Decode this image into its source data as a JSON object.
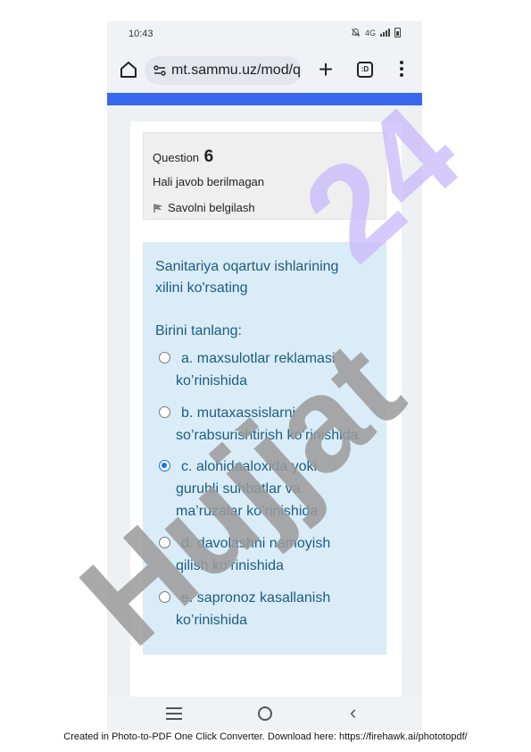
{
  "statusbar": {
    "time": "10:43",
    "network": "4G"
  },
  "browser": {
    "url": "mt.sammu.uz/mod/q",
    "tabs_label": ":D"
  },
  "question": {
    "label": "Question",
    "number": "6",
    "state": "Hali javob berilmagan",
    "flag_label": "Savolni belgilash",
    "text": "Sanitariya oqartuv ishlarining xilini ko'rsating",
    "prompt": "Birini tanlang:",
    "answers": [
      {
        "lines": [
          "a. maxsulotlar reklamasi",
          "ko’rinishida"
        ],
        "checked": false
      },
      {
        "lines": [
          "b. mutaxassislarni",
          "so’rabsurishtirish ko’rinishida"
        ],
        "checked": false
      },
      {
        "lines": [
          "c. alohidaaloxida yoki",
          "guruhli suhbatlar va",
          "ma’ruzalar ko’rinishida"
        ],
        "checked": true
      },
      {
        "lines": [
          "d. davolashni namoyish",
          "qilish ko’rinishida"
        ],
        "checked": false
      },
      {
        "lines": [
          "e. sapronoz kasallanish",
          "ko’rinishida"
        ],
        "checked": false
      }
    ]
  },
  "watermark": {
    "text": "Hujjat24",
    "colors": {
      "gray": "#9a9a9a",
      "violet": "#c8b8fb"
    }
  },
  "footer": {
    "text": "Created in Photo-to-PDF One Click Converter. Download here: https://firehawk.ai/phototopdf/"
  },
  "colors": {
    "accent": "#3868f0",
    "question_bg": "#d9ecf7",
    "question_text": "#1d5d80",
    "radio_checked": "#1a73e8"
  }
}
